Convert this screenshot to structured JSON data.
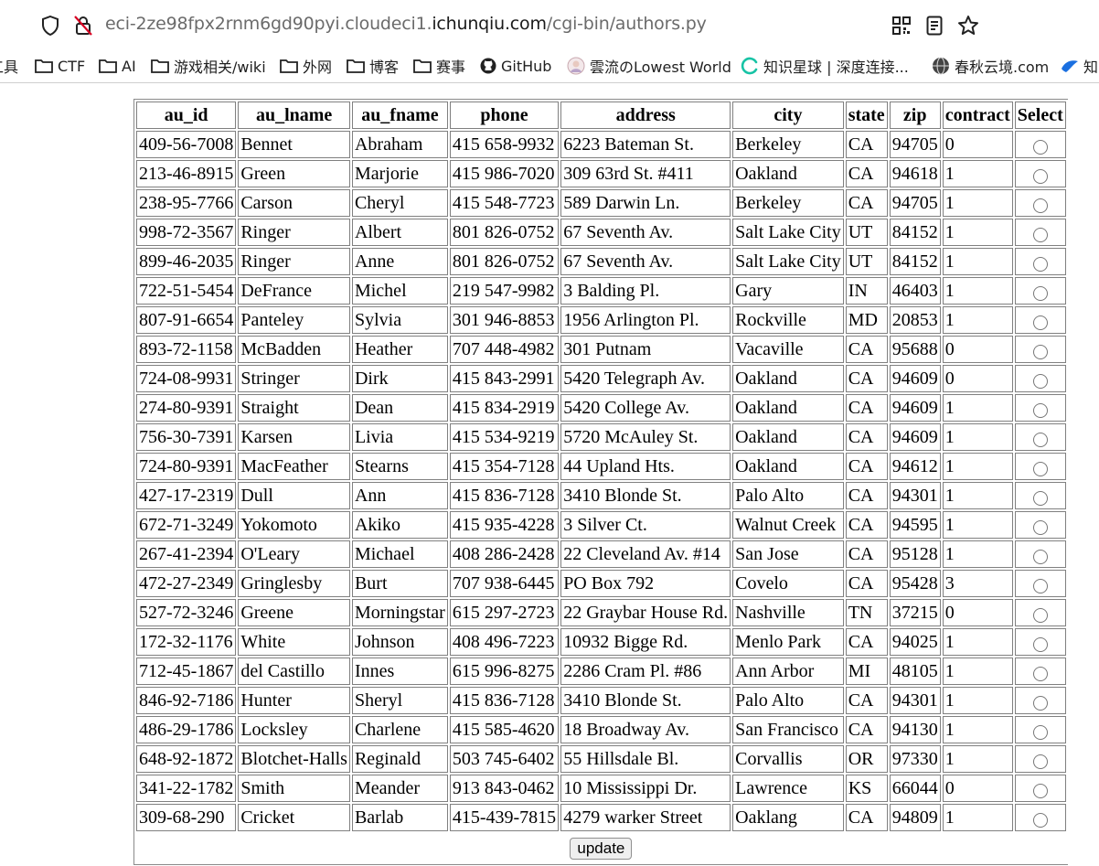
{
  "browser": {
    "url_prefix": "eci-2ze98fpx2rnm6gd90pyi.cloudeci1.",
    "url_host": "ichunqiu.com",
    "url_path": "/cgi-bin/authors.py",
    "icons": [
      "shield-icon",
      "insecure-lock-icon",
      "qr-code-icon",
      "reader-view-icon",
      "star-bookmark-icon"
    ]
  },
  "bookmarks": [
    {
      "label": "工具",
      "icon": "none"
    },
    {
      "label": "CTF",
      "icon": "folder-icon"
    },
    {
      "label": "AI",
      "icon": "folder-icon"
    },
    {
      "label": "游戏相关/wiki",
      "icon": "folder-icon"
    },
    {
      "label": "外网",
      "icon": "folder-icon"
    },
    {
      "label": "博客",
      "icon": "folder-icon"
    },
    {
      "label": "赛事",
      "icon": "folder-icon"
    },
    {
      "label": "GitHub",
      "icon": "github-icon"
    },
    {
      "label": "雲流のLowest World",
      "icon": "avatar-icon"
    },
    {
      "label": "知识星球 | 深度连接...",
      "icon": "zsxq-icon"
    },
    {
      "label": "春秋云境.com",
      "icon": "globe-icon"
    },
    {
      "label": "知",
      "icon": "bird-icon"
    }
  ],
  "table": {
    "headers": [
      "au_id",
      "au_lname",
      "au_fname",
      "phone",
      "address",
      "city",
      "state",
      "zip",
      "contract",
      "Select"
    ],
    "rows": [
      [
        "409-56-7008",
        "Bennet",
        "Abraham",
        "415 658-9932",
        "6223 Bateman St.",
        "Berkeley",
        "CA",
        "94705",
        "0"
      ],
      [
        "213-46-8915",
        "Green",
        "Marjorie",
        "415 986-7020",
        "309 63rd St. #411",
        "Oakland",
        "CA",
        "94618",
        "1"
      ],
      [
        "238-95-7766",
        "Carson",
        "Cheryl",
        "415 548-7723",
        "589 Darwin Ln.",
        "Berkeley",
        "CA",
        "94705",
        "1"
      ],
      [
        "998-72-3567",
        "Ringer",
        "Albert",
        "801 826-0752",
        "67 Seventh Av.",
        "Salt Lake City",
        "UT",
        "84152",
        "1"
      ],
      [
        "899-46-2035",
        "Ringer",
        "Anne",
        "801 826-0752",
        "67 Seventh Av.",
        "Salt Lake City",
        "UT",
        "84152",
        "1"
      ],
      [
        "722-51-5454",
        "DeFrance",
        "Michel",
        "219 547-9982",
        "3 Balding Pl.",
        "Gary",
        "IN",
        "46403",
        "1"
      ],
      [
        "807-91-6654",
        "Panteley",
        "Sylvia",
        "301 946-8853",
        "1956 Arlington Pl.",
        "Rockville",
        "MD",
        "20853",
        "1"
      ],
      [
        "893-72-1158",
        "McBadden",
        "Heather",
        "707 448-4982",
        "301 Putnam",
        "Vacaville",
        "CA",
        "95688",
        "0"
      ],
      [
        "724-08-9931",
        "Stringer",
        "Dirk",
        "415 843-2991",
        "5420 Telegraph Av.",
        "Oakland",
        "CA",
        "94609",
        "0"
      ],
      [
        "274-80-9391",
        "Straight",
        "Dean",
        "415 834-2919",
        "5420 College Av.",
        "Oakland",
        "CA",
        "94609",
        "1"
      ],
      [
        "756-30-7391",
        "Karsen",
        "Livia",
        "415 534-9219",
        "5720 McAuley St.",
        "Oakland",
        "CA",
        "94609",
        "1"
      ],
      [
        "724-80-9391",
        "MacFeather",
        "Stearns",
        "415 354-7128",
        "44 Upland Hts.",
        "Oakland",
        "CA",
        "94612",
        "1"
      ],
      [
        "427-17-2319",
        "Dull",
        "Ann",
        "415 836-7128",
        "3410 Blonde St.",
        "Palo Alto",
        "CA",
        "94301",
        "1"
      ],
      [
        "672-71-3249",
        "Yokomoto",
        "Akiko",
        "415 935-4228",
        "3 Silver Ct.",
        "Walnut Creek",
        "CA",
        "94595",
        "1"
      ],
      [
        "267-41-2394",
        "O'Leary",
        "Michael",
        "408 286-2428",
        "22 Cleveland Av. #14",
        "San Jose",
        "CA",
        "95128",
        "1"
      ],
      [
        "472-27-2349",
        "Gringlesby",
        "Burt",
        "707 938-6445",
        "PO Box 792",
        "Covelo",
        "CA",
        "95428",
        "3"
      ],
      [
        "527-72-3246",
        "Greene",
        "Morningstar",
        "615 297-2723",
        "22 Graybar House Rd.",
        "Nashville",
        "TN",
        "37215",
        "0"
      ],
      [
        "172-32-1176",
        "White",
        "Johnson",
        "408 496-7223",
        "10932 Bigge Rd.",
        "Menlo Park",
        "CA",
        "94025",
        "1"
      ],
      [
        "712-45-1867",
        "del Castillo",
        "Innes",
        "615 996-8275",
        "2286 Cram Pl. #86",
        "Ann Arbor",
        "MI",
        "48105",
        "1"
      ],
      [
        "846-92-7186",
        "Hunter",
        "Sheryl",
        "415 836-7128",
        "3410 Blonde St.",
        "Palo Alto",
        "CA",
        "94301",
        "1"
      ],
      [
        "486-29-1786",
        "Locksley",
        "Charlene",
        "415 585-4620",
        "18 Broadway Av.",
        "San Francisco",
        "CA",
        "94130",
        "1"
      ],
      [
        "648-92-1872",
        "Blotchet-Halls",
        "Reginald",
        "503 745-6402",
        "55 Hillsdale Bl.",
        "Corvallis",
        "OR",
        "97330",
        "1"
      ],
      [
        "341-22-1782",
        "Smith",
        "Meander",
        "913 843-0462",
        "10 Mississippi Dr.",
        "Lawrence",
        "KS",
        "66044",
        "0"
      ],
      [
        "309-68-290",
        "Cricket",
        "Barlab",
        "415-439-7815",
        "4279 warker Street",
        "Oaklang",
        "CA",
        "94809",
        "1"
      ]
    ]
  },
  "form": {
    "update_label": "update"
  }
}
